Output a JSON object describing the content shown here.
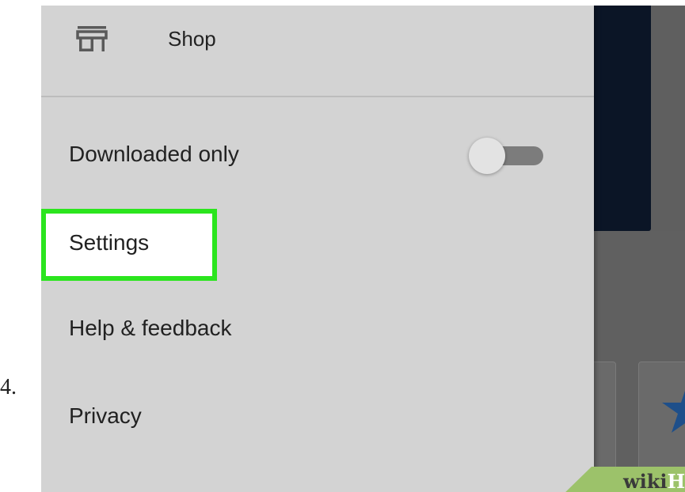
{
  "step": {
    "number": "4."
  },
  "drawer": {
    "shop": {
      "icon": "store-icon",
      "label": "Shop"
    },
    "items": [
      {
        "label": "Downloaded only",
        "toggle": {
          "state": "off"
        }
      },
      {
        "label": "Settings",
        "highlighted": true
      },
      {
        "label": "Help & feedback"
      },
      {
        "label": "Privacy"
      }
    ]
  },
  "watermark": {
    "part1": "wiki",
    "part2": "How"
  },
  "colors": {
    "drawer_background": "#d3d3d3",
    "highlight_border": "#2be51e",
    "toggle_track": "#7c7c7c",
    "toggle_thumb": "#e3e3e3",
    "background_dark_card": "#0b1526",
    "watermark_green": "#9cc26a"
  }
}
